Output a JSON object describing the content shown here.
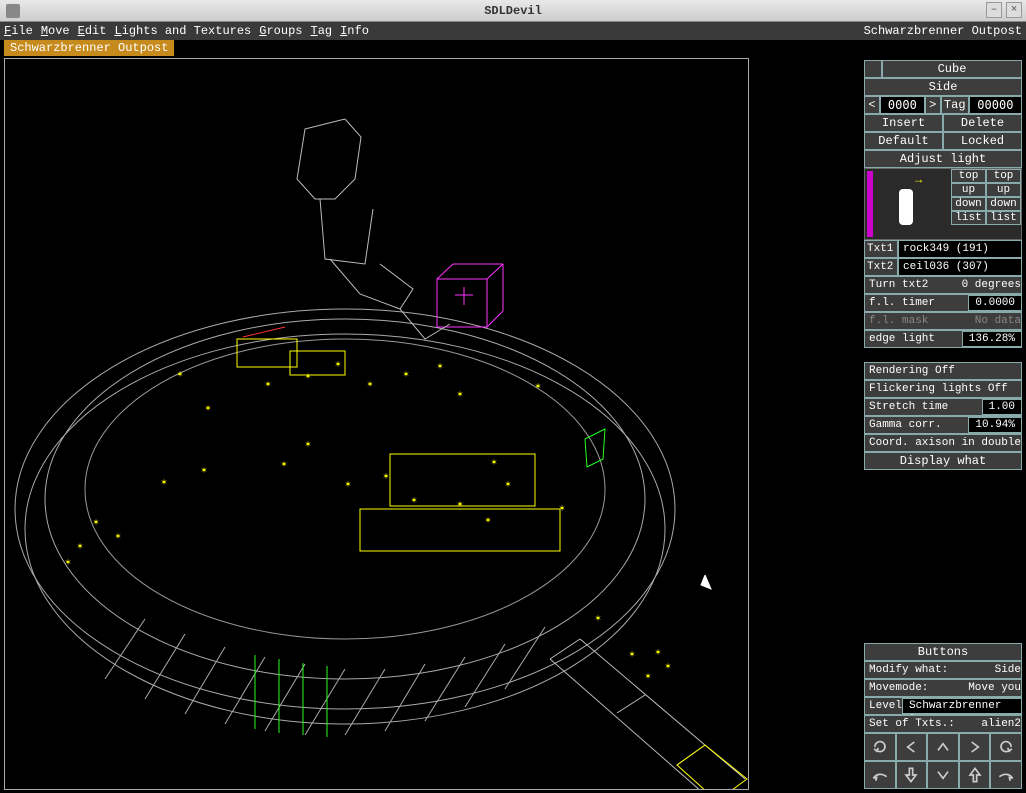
{
  "window": {
    "title": "SDLDevil"
  },
  "menubar": {
    "items": [
      "File",
      "Move",
      "Edit",
      "Lights and Textures",
      "Groups",
      "Tag",
      "Info"
    ],
    "level_name": "Schwarzbrenner Outpost"
  },
  "canvas": {
    "tab": "Schwarzbrenner Outpost"
  },
  "panel_cube": {
    "header_small": "",
    "header_main": "Cube",
    "subheader": "Side",
    "nav": {
      "prev": "<",
      "index": "0000",
      "next": ">",
      "tag_label": "Tag",
      "tag_value": "00000"
    },
    "actions": {
      "insert": "Insert",
      "delete": "Delete",
      "default": "Default",
      "locked": "Locked"
    },
    "adjust": "Adjust light",
    "thumb_controls": {
      "top": "top",
      "up": "up",
      "down": "down",
      "list": "list"
    },
    "txt1": {
      "label": "Txt1",
      "value": "rock349 (191)"
    },
    "txt2": {
      "label": "Txt2",
      "value": "ceil036 (307)"
    },
    "turn": {
      "label": "Turn txt2",
      "value": "0 degrees"
    },
    "fl_timer": {
      "label": "f.l. timer",
      "value": "0.0000"
    },
    "fl_mask": {
      "label": "f.l. mask",
      "value": "No data"
    },
    "edge_light": {
      "label": "edge light",
      "value": "136.28%"
    }
  },
  "panel_render": {
    "rendering": "Rendering Off",
    "flickering": "Flickering lights Off",
    "stretch": {
      "label": "Stretch time",
      "value": "1.00"
    },
    "gamma": {
      "label": "Gamma corr.",
      "value": "10.94%"
    },
    "coord": {
      "label": "Coord. axis",
      "options": "on in double"
    },
    "display_what": "Display what"
  },
  "panel_buttons": {
    "header": "Buttons",
    "modify": {
      "label": "Modify what:",
      "value": "Side"
    },
    "movemode": {
      "label": "Movemode:",
      "value": "Move you"
    },
    "level": {
      "label": "Level",
      "value": "Schwarzbrenner Ou"
    },
    "txtset": {
      "label": "Set of Txts.:",
      "value": "alien2"
    }
  }
}
